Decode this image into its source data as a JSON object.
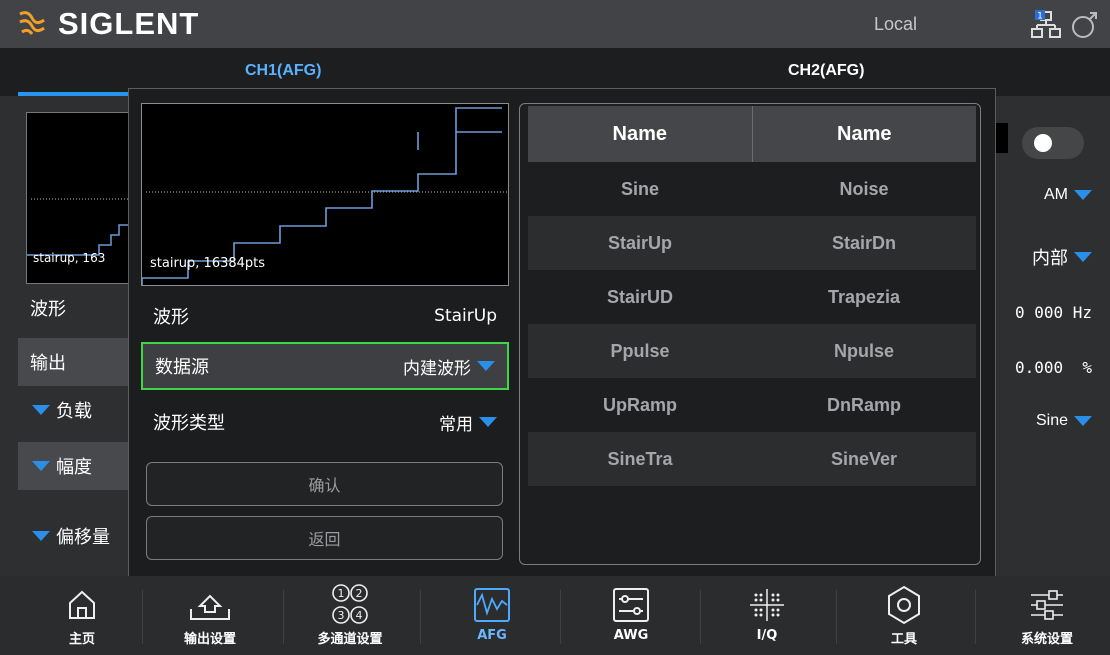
{
  "header": {
    "brand": "SIGLENT",
    "status": "Local",
    "badge": "1"
  },
  "tabs": [
    {
      "label": "CH1(AFG)",
      "active": true
    },
    {
      "label": "CH2(AFG)",
      "active": false
    }
  ],
  "background": {
    "preview_caption": "stairup, 163",
    "rows": [
      {
        "label": "波形"
      },
      {
        "label": "输出"
      },
      {
        "label": "负载"
      },
      {
        "label": "幅度"
      },
      {
        "label": "偏移量"
      }
    ],
    "right_values": [
      {
        "value": "AM"
      },
      {
        "value": "内部"
      },
      {
        "value": "0 000 Hz"
      },
      {
        "value": "0.000  %"
      },
      {
        "value": "Sine"
      }
    ]
  },
  "dialog": {
    "preview_caption": "stairup, 16384pts",
    "rows": [
      {
        "label": "波形",
        "value": "StairUp"
      },
      {
        "label": "数据源",
        "value": "内建波形"
      },
      {
        "label": "波形类型",
        "value": "常用"
      }
    ],
    "confirm_label": "确认",
    "back_label": "返回",
    "list": {
      "headers": [
        "Name",
        "Name"
      ],
      "rows": [
        [
          "Sine",
          "Noise"
        ],
        [
          "StairUp",
          "StairDn"
        ],
        [
          "StairUD",
          "Trapezia"
        ],
        [
          "Ppulse",
          "Npulse"
        ],
        [
          "UpRamp",
          "DnRamp"
        ],
        [
          "SineTra",
          "SineVer"
        ]
      ]
    }
  },
  "bottom_nav": [
    {
      "label": "主页",
      "icon": "home-icon"
    },
    {
      "label": "输出设置",
      "icon": "output-settings-icon"
    },
    {
      "label": "多通道设置",
      "icon": "multi-channel-icon"
    },
    {
      "label": "AFG",
      "icon": "afg-icon",
      "active": true
    },
    {
      "label": "AWG",
      "icon": "awg-icon"
    },
    {
      "label": "I/Q",
      "icon": "iq-icon"
    },
    {
      "label": "工具",
      "icon": "tools-icon"
    },
    {
      "label": "系统设置",
      "icon": "system-settings-icon"
    }
  ],
  "colors": {
    "accent": "#2796f0",
    "highlight_border": "#41d447",
    "trace": "#6e9ad8"
  }
}
